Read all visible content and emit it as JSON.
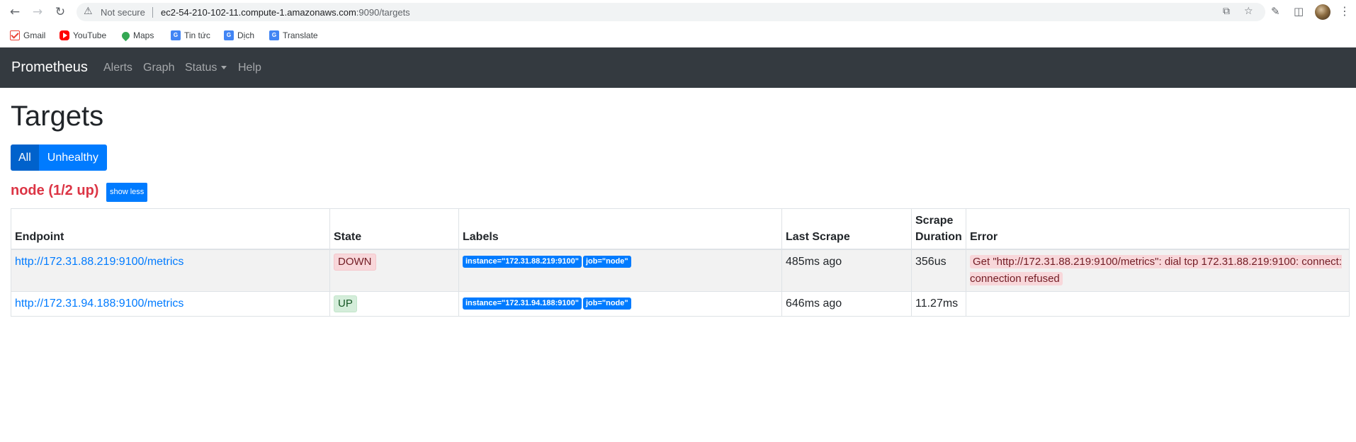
{
  "browser": {
    "security_label": "Not secure",
    "url_host": "ec2-54-210-102-11.compute-1.amazonaws.com",
    "url_rest": ":9090/targets",
    "bookmarks": [
      {
        "label": "Gmail",
        "icon": "gmail-icon"
      },
      {
        "label": "YouTube",
        "icon": "youtube-icon"
      },
      {
        "label": "Maps",
        "icon": "maps-icon"
      },
      {
        "label": "Tin tức",
        "icon": "news-icon"
      },
      {
        "label": "Dịch",
        "icon": "translate-icon"
      },
      {
        "label": "Translate",
        "icon": "translate-icon"
      }
    ]
  },
  "navbar": {
    "brand": "Prometheus",
    "links": [
      "Alerts",
      "Graph",
      "Status",
      "Help"
    ]
  },
  "page": {
    "title": "Targets",
    "filter_all": "All",
    "filter_unhealthy": "Unhealthy",
    "job_title": "node (1/2 up)",
    "show_less": "show less"
  },
  "table": {
    "headers": {
      "endpoint": "Endpoint",
      "state": "State",
      "labels": "Labels",
      "last_scrape": "Last Scrape",
      "scrape_duration": "Scrape Duration",
      "error": "Error"
    },
    "rows": [
      {
        "endpoint": "http://172.31.88.219:9100/metrics",
        "state": "DOWN",
        "labels": [
          "instance=\"172.31.88.219:9100\"",
          "job=\"node\""
        ],
        "last_scrape": "485ms ago",
        "scrape_duration": "356us",
        "error": "Get \"http://172.31.88.219:9100/metrics\": dial tcp 172.31.88.219:9100: connect: connection refused"
      },
      {
        "endpoint": "http://172.31.94.188:9100/metrics",
        "state": "UP",
        "labels": [
          "instance=\"172.31.94.188:9100\"",
          "job=\"node\""
        ],
        "last_scrape": "646ms ago",
        "scrape_duration": "11.27ms",
        "error": ""
      }
    ]
  },
  "colors": {
    "navbar_bg": "#343a40",
    "primary": "#007bff",
    "danger": "#dc3545",
    "down_bg": "#f8d7da",
    "up_bg": "#d4edda"
  }
}
